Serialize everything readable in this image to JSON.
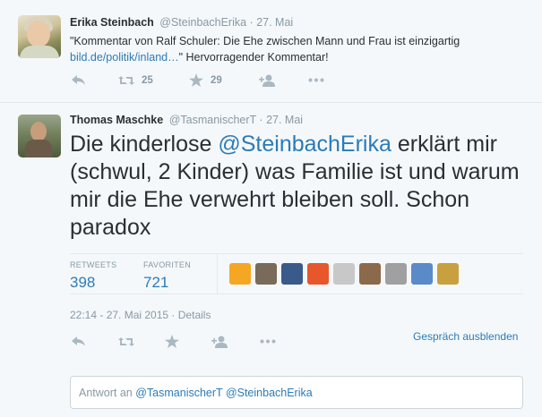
{
  "tweet1": {
    "name": "Erika Steinbach",
    "handle": "@SteinbachErika",
    "separator": "·",
    "date": "27. Mai",
    "text_line1": "\"Kommentar von Ralf Schuler: Die Ehe zwischen Mann und Frau ist einzigartig",
    "link": "bild.de/politik/inland…",
    "text_after_link": "\" Hervorragender Kommentar!",
    "retweets": "25",
    "favorites": "29"
  },
  "tweet2": {
    "name": "Thomas Maschke",
    "handle": "@TasmanischerT",
    "separator": "·",
    "date": "27. Mai",
    "text_before": "Die kinderlose ",
    "mention": "@SteinbachErika",
    "text_after": " erklärt mir (schwul, 2 Kinder) was Familie ist und warum mir die Ehe verwehrt bleiben soll. Schon paradox",
    "retweets_label": "RETWEETS",
    "retweets_count": "398",
    "favorites_label": "FAVORITEN",
    "favorites_count": "721",
    "timestamp": "22:14 - 27. Mai 2015",
    "details": "Details",
    "conversation_toggle": "Gespräch ausblenden",
    "reply_prefix": "Antwort an ",
    "reply_mention1": "@TasmanischerT",
    "reply_mention2": "@SteinbachErika"
  },
  "icons": {
    "reply": "reply-icon",
    "retweet": "retweet-icon",
    "favorite": "star-icon",
    "follow": "follow-icon",
    "more": "more-icon"
  },
  "favoriter_avatar_colors": [
    "#f5a623",
    "#7a6a5a",
    "#3a5a8a",
    "#e8562b",
    "#c8c8c8",
    "#8a6a4a",
    "#a0a0a0",
    "#5a8ac8",
    "#c8a040"
  ],
  "colors": {
    "link": "#2b7bb9",
    "muted": "#8899a6",
    "text": "#292f33",
    "background": "#f5f8fa"
  }
}
